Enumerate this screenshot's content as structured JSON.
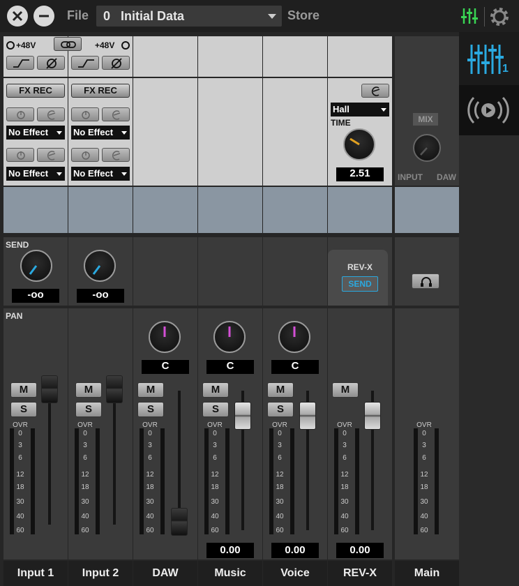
{
  "topbar": {
    "file_label": "File",
    "scene_number": "0",
    "scene_name": "Initial Data",
    "store_label": "Store"
  },
  "input_section": {
    "phantom_label_1": "+48V",
    "phantom_label_2": "+48V",
    "fx_rec_label": "FX REC",
    "effect_options_selected": [
      "No Effect",
      "No Effect",
      "No Effect",
      "No Effect"
    ]
  },
  "reverb": {
    "type_selected": "Hall",
    "time_label": "TIME",
    "time_value": "2.51",
    "rev_label": "REV-X",
    "send_label": "SEND"
  },
  "main": {
    "mix_label": "MIX",
    "input_label": "INPUT",
    "daw_label": "DAW"
  },
  "sends": {
    "title": "SEND",
    "values": [
      "-oo",
      "-oo"
    ]
  },
  "pan": {
    "title": "PAN",
    "values": [
      "C",
      "C",
      "C"
    ]
  },
  "buttons": {
    "mute": "M",
    "solo": "S"
  },
  "meter_scale": [
    "OVR",
    "0",
    "3",
    "6",
    "12",
    "18",
    "30",
    "40",
    "60"
  ],
  "fader_values": [
    "0.00",
    "0.00",
    "0.00"
  ],
  "channels": [
    "Input 1",
    "Input 2",
    "DAW",
    "Music",
    "Voice",
    "REV-X",
    "Main"
  ],
  "sidetabs": {
    "mixer_tab_badge": "1"
  },
  "colors": {
    "accent_cyan": "#2aa9e0",
    "accent_green": "#39d353",
    "pan_pink": "#d44fd6"
  }
}
